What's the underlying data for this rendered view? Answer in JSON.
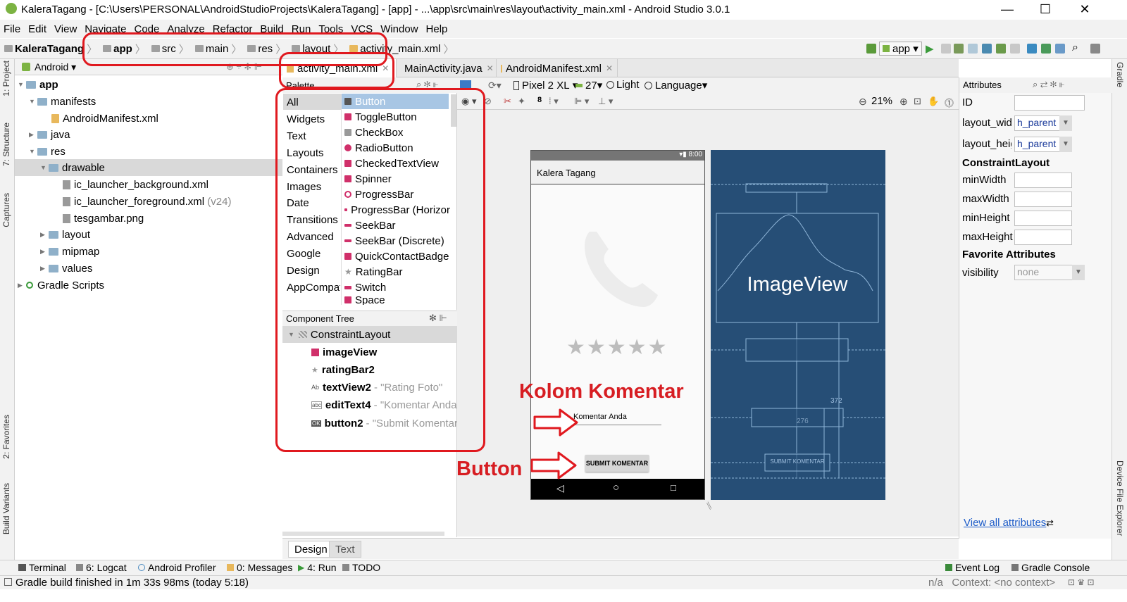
{
  "window": {
    "title": "KaleraTagang - [C:\\Users\\PERSONAL\\AndroidStudioProjects\\KaleraTagang] - [app] - ...\\app\\src\\main\\res\\layout\\activity_main.xml - Android Studio 3.0.1",
    "minimize": "—",
    "maximize": "☐",
    "close": "✕"
  },
  "menu": [
    "File",
    "Edit",
    "View",
    "Navigate",
    "Code",
    "Analyze",
    "Refactor",
    "Build",
    "Run",
    "Tools",
    "VCS",
    "Window",
    "Help"
  ],
  "breadcrumb": [
    "KaleraTagang",
    "app",
    "src",
    "main",
    "res",
    "layout",
    "activity_main.xml"
  ],
  "run_config": "app",
  "project_panel": {
    "view": "Android"
  },
  "tree": [
    {
      "label": "app",
      "bold": true
    },
    {
      "label": "manifests"
    },
    {
      "label": "AndroidManifest.xml"
    },
    {
      "label": "java"
    },
    {
      "label": "res"
    },
    {
      "label": "drawable"
    },
    {
      "label": "ic_launcher_background.xml"
    },
    {
      "label": "ic_launcher_foreground.xml",
      "suffix": "(v24)"
    },
    {
      "label": "tesgambar.png"
    },
    {
      "label": "layout"
    },
    {
      "label": "mipmap"
    },
    {
      "label": "values"
    },
    {
      "label": "Gradle Scripts"
    }
  ],
  "tabs": [
    "activity_main.xml",
    "MainActivity.java",
    "AndroidManifest.xml"
  ],
  "palette": {
    "title": "Palette",
    "categories": [
      "All",
      "Widgets",
      "Text",
      "Layouts",
      "Containers",
      "Images",
      "Date",
      "Transitions",
      "Advanced",
      "Google",
      "Design",
      "AppCompat"
    ],
    "items": [
      "Button",
      "ToggleButton",
      "CheckBox",
      "RadioButton",
      "CheckedTextView",
      "Spinner",
      "ProgressBar",
      "ProgressBar (Horizor",
      "SeekBar",
      "SeekBar (Discrete)",
      "QuickContactBadge",
      "RatingBar",
      "Switch",
      "Space"
    ]
  },
  "component_tree": {
    "title": "Component Tree",
    "root": "ConstraintLayout",
    "items": [
      {
        "name": "imageView",
        "text": ""
      },
      {
        "name": "ratingBar2",
        "text": ""
      },
      {
        "name": "textView2",
        "text": "- \"Rating Foto\""
      },
      {
        "name": "editText4",
        "text": "- \"Komentar Anda\""
      },
      {
        "name": "button2",
        "text": "- \"Submit Komentar\""
      }
    ]
  },
  "design_toolbar": {
    "device": "Pixel 2 XL",
    "api": "27",
    "theme": "Light",
    "language": "Language",
    "zoom": "21%"
  },
  "preview": {
    "status_time": "8:00",
    "app_title": "Kalera Tagang",
    "stars": "★★★★★",
    "edit_text": "Komentar Anda",
    "button_text": "SUBMIT KOMENTAR",
    "blueprint_image_label": "ImageView",
    "blueprint_dim1": "372",
    "blueprint_dim2": "276",
    "blueprint_button": "SUBMIT KOMENTAR"
  },
  "annotations": {
    "kolom_komentar": "Kolom Komentar",
    "button": "Button"
  },
  "attributes": {
    "title": "Attributes",
    "id_label": "ID",
    "layout_width_label": "layout_wid",
    "layout_width_value": "h_parent",
    "layout_height_label": "layout_heig",
    "layout_height_value": "h_parent",
    "section1": "ConstraintLayout",
    "minWidth": "minWidth",
    "maxWidth": "maxWidth",
    "minHeight": "minHeight",
    "maxHeight": "maxHeight",
    "section2": "Favorite Attributes",
    "visibility_label": "visibility",
    "visibility_value": "none",
    "view_all": "View all attributes"
  },
  "design_tabs": [
    "Design",
    "Text"
  ],
  "tool_windows_left": [
    "1: Project",
    "7: Structure",
    "Captures",
    "2: Favorites",
    "Build Variants"
  ],
  "tool_windows_right": [
    "Gradle",
    "Device File Explorer"
  ],
  "bottom_tools": [
    "Terminal",
    "6: Logcat",
    "Android Profiler",
    "0: Messages",
    "4: Run",
    "TODO"
  ],
  "bottom_tools_right": [
    "Event Log",
    "Gradle Console"
  ],
  "status": {
    "message": "Gradle build finished in 1m 33s 98ms (today 5:18)",
    "right": "n/a   Context: <no context>"
  },
  "colors": {
    "annotation_red": "#e0191f",
    "blueprint": "#264e76",
    "selection": "#a8c6e4"
  }
}
